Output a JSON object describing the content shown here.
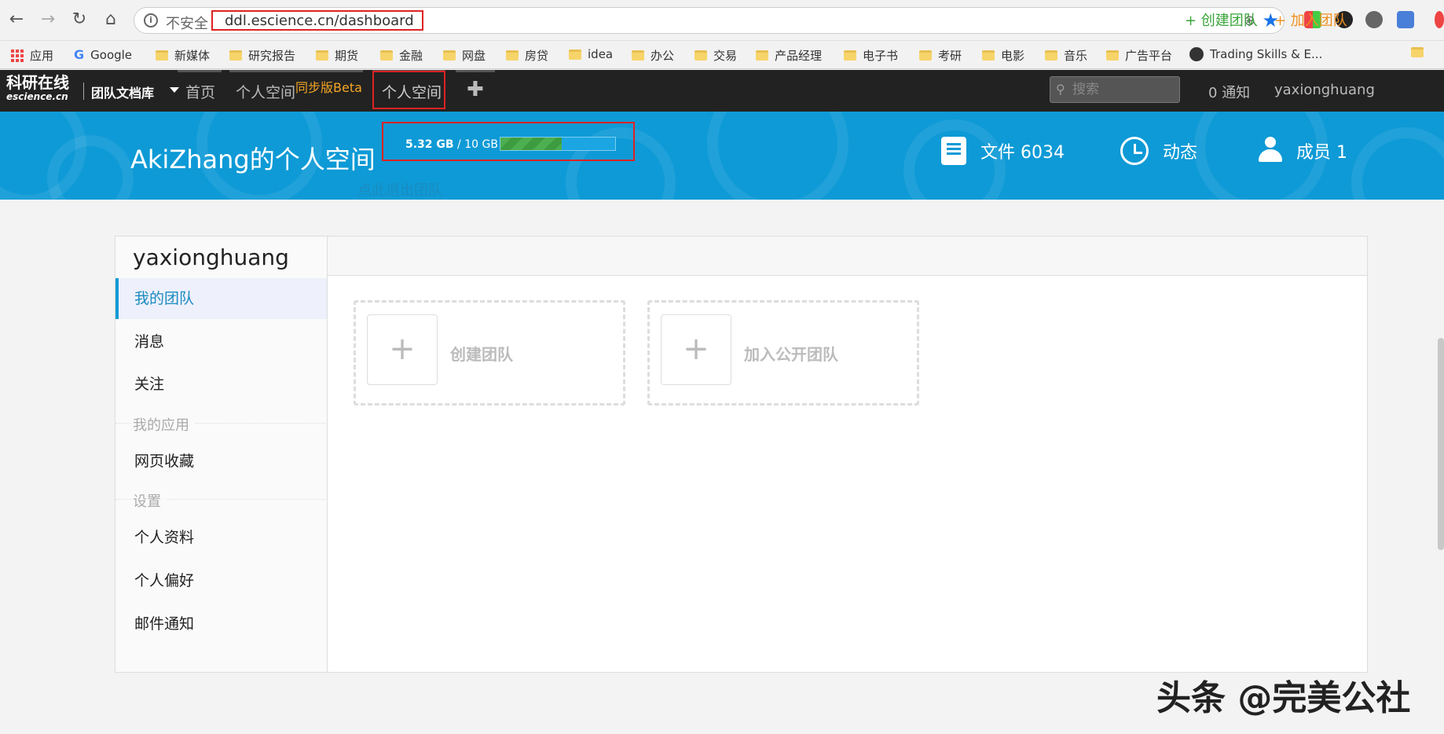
{
  "browser": {
    "insecure_label": "不安全",
    "url": "ddl.escience.cn/dashboard",
    "bookmarks": [
      "应用",
      "Google",
      "新媒体",
      "研究报告",
      "期货",
      "金融",
      "网盘",
      "房贷",
      "idea",
      "办公",
      "交易",
      "产品经理",
      "电子书",
      "考研",
      "电影",
      "音乐",
      "广告平台",
      "Trading Skills & E..."
    ]
  },
  "site": {
    "logo_cn": "科研在线",
    "logo_en": "escience.cn",
    "team_lib": "团队文档库",
    "nav": {
      "home": "首页",
      "personal_space_sync": "个人空间",
      "sync_beta": "同步版Beta",
      "personal_space": "个人空间"
    },
    "search_placeholder": "搜索",
    "notice_count": "0",
    "notice_label": "通知",
    "username": "yaxionghuang"
  },
  "banner": {
    "title": "AkiZhang的个人空间",
    "quota_used": "5.32 GB",
    "quota_sep": " / ",
    "quota_total": "10 GB",
    "quota_fraction": 0.532,
    "files_label": "文件 6034",
    "activity_label": "动态",
    "members_label": "成员 1"
  },
  "sidebar": {
    "user": "yaxionghuang",
    "my_teams": "我的团队",
    "messages": "消息",
    "follow": "关注",
    "group_apps": "我的应用",
    "bookmarks": "网页收藏",
    "group_settings": "设置",
    "profile": "个人资料",
    "preferences": "个人偏好",
    "mail_notify": "邮件通知"
  },
  "main": {
    "create_team_link": "+ 创建团队",
    "join_team_link": "+ 加入团队",
    "card_create": "创建团队",
    "card_join": "加入公开团队",
    "card_plus": "+",
    "leave_team": "点此退出团队"
  },
  "watermark": "头条 @完美公社",
  "colors": {
    "banner": "#0e9ad6",
    "topbar": "#222222",
    "accent_green": "#3aa53a",
    "accent_orange": "#f0901e"
  }
}
